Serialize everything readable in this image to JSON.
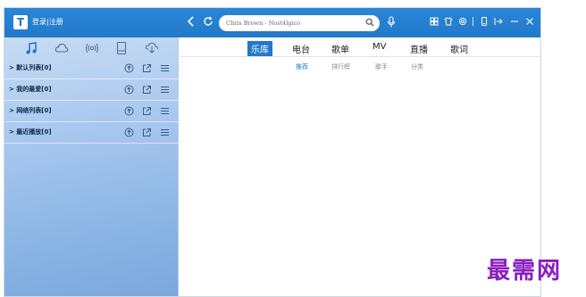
{
  "app": {
    "logo_letter": "T",
    "login_text": "登录|注册",
    "colors": {
      "brand": "#2379c9",
      "sidebar": "#a9c8ef",
      "watermark": "#8b1dbf"
    }
  },
  "topbar": {
    "back_icon": "chevron-left-icon",
    "refresh_icon": "refresh-icon",
    "search": {
      "value": "Chris Brown - Nost4lgico",
      "icon": "search-icon"
    },
    "mic_icon": "mic-icon",
    "right_icons": [
      "skin-icon",
      "shirt-icon",
      "settings-icon",
      "mobile-icon",
      "mini-mode-icon",
      "minimize-icon",
      "close-icon"
    ]
  },
  "sidebar": {
    "nav_icons": [
      "music-note-icon",
      "cloud-icon",
      "radio-icon",
      "device-icon",
      "download-icon"
    ],
    "playlists": [
      {
        "label": "> 默认列表[0]"
      },
      {
        "label": "> 我的最爱[0]"
      },
      {
        "label": "> 网络列表[0]"
      },
      {
        "label": "> 最近播放[0]"
      }
    ],
    "row_icons": [
      "upload-icon",
      "share-icon",
      "menu-icon"
    ]
  },
  "main": {
    "tabs": [
      {
        "label": "乐库",
        "active": true
      },
      {
        "label": "电台",
        "active": false
      },
      {
        "label": "歌单",
        "active": false
      },
      {
        "label": "MV",
        "active": false
      },
      {
        "label": "直播",
        "active": false
      },
      {
        "label": "歌词",
        "active": false
      }
    ],
    "subtabs": [
      {
        "label": "推荐",
        "active": true
      },
      {
        "label": "排行榜",
        "active": false
      },
      {
        "label": "歌手",
        "active": false
      },
      {
        "label": "分类",
        "active": false
      }
    ]
  },
  "watermark": "最需网"
}
